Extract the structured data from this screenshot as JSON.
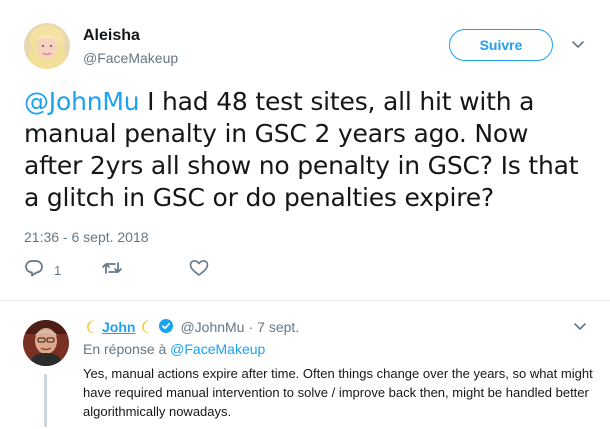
{
  "tweet": {
    "author_name": "Aleisha",
    "author_handle": "@FaceMakeup",
    "follow_label": "Suivre",
    "mention": "@JohnMu",
    "text": " I had 48 test sites, all hit with a manual penalty in GSC 2 years ago. Now after 2yrs all show no penalty in GSC? Is that a glitch in GSC or do penalties expire?",
    "timestamp": "21:36 - 6 sept. 2018",
    "reply_count": "1"
  },
  "reply": {
    "author_name": "John",
    "author_handle": "@JohnMu",
    "separator": "·",
    "date": "7 sept.",
    "replying_prefix": "En réponse à ",
    "replying_handle": "@FaceMakeup",
    "text": "Yes, manual actions expire after time. Often things change over the years, so what might have required manual intervention to solve / improve back then, might be handled better algorithmically nowadays."
  },
  "colors": {
    "accent": "#1da1f2",
    "text": "#14171a",
    "muted": "#657786",
    "divider": "#e6ecf0"
  },
  "icons": [
    "chevron-down-icon",
    "reply-icon",
    "retweet-icon",
    "like-icon",
    "verified-icon",
    "crescent-moon-icon"
  ]
}
